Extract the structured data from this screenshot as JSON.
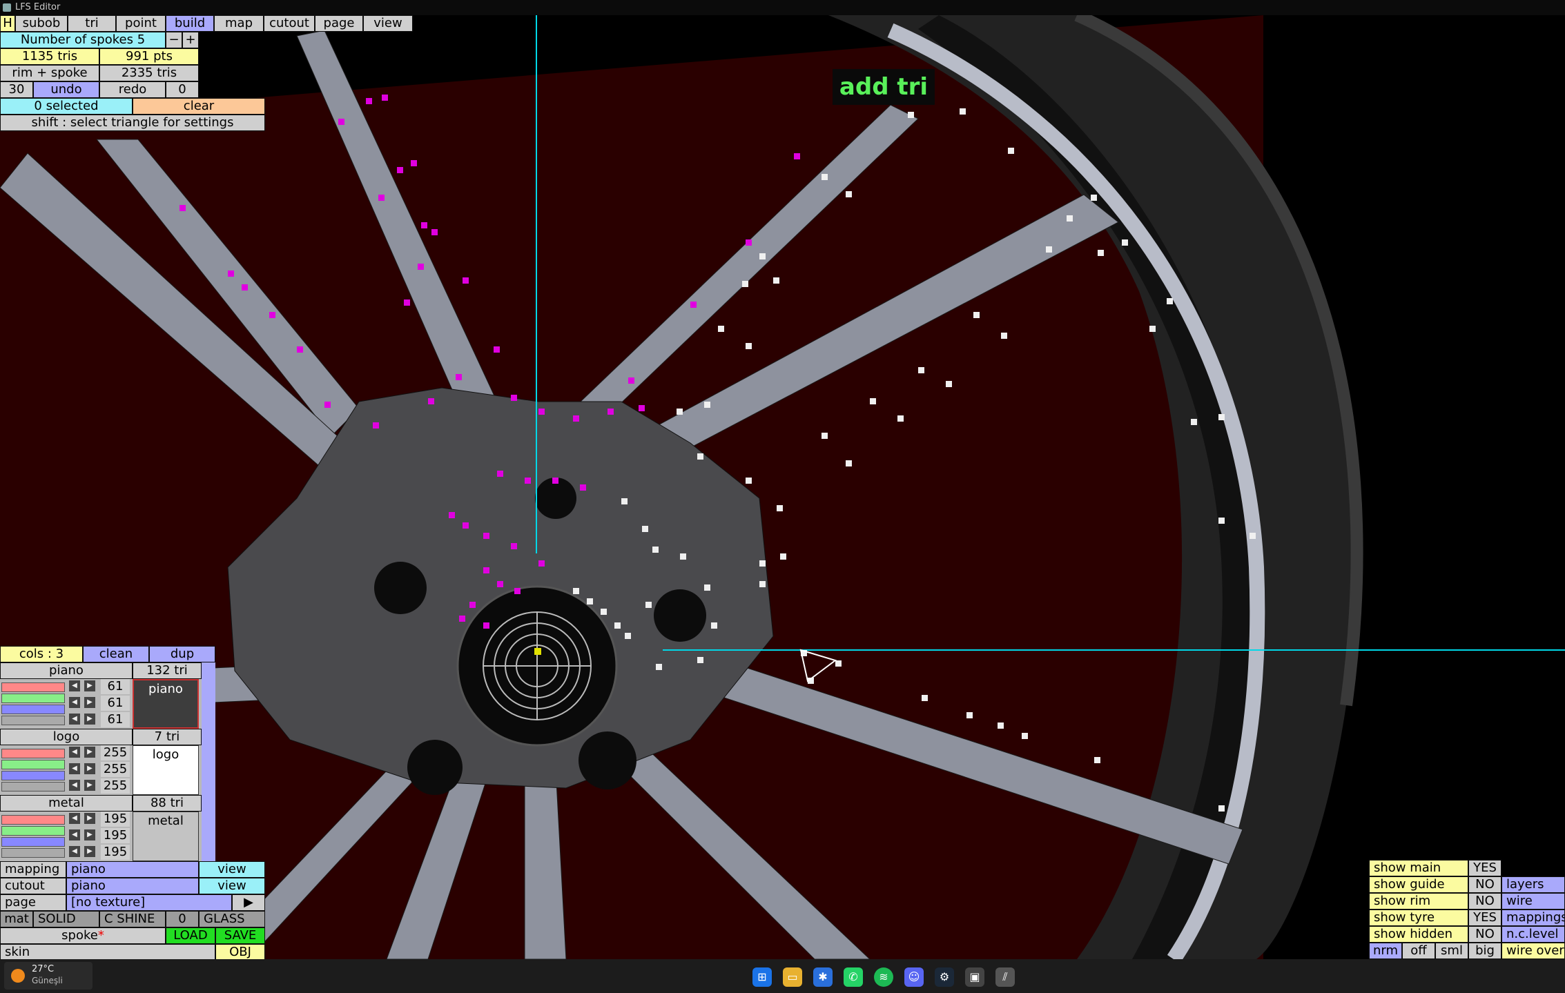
{
  "window": {
    "title": "LFS Editor"
  },
  "menu": [
    "H",
    "subob",
    "tri",
    "point",
    "build",
    "map",
    "cutout",
    "page",
    "view"
  ],
  "spokes": {
    "label": "Number of spokes 5",
    "minus": "−",
    "plus": "+"
  },
  "stats": {
    "tris": "1135 tris",
    "pts": "991 pts",
    "rim_spoke": "rim + spoke",
    "total_tris": "2335 tris"
  },
  "history": {
    "count": "30",
    "undo": "undo",
    "redo": "redo",
    "redo_count": "0"
  },
  "selection": {
    "selected": "0 selected",
    "clear": "clear",
    "hint": "shift : select triangle for settings"
  },
  "overlay": {
    "mode": "add tri"
  },
  "colours": {
    "header": "cols : 3",
    "clean": "clean",
    "dup": "dup",
    "items": [
      {
        "name": "piano",
        "tri": "132 tri",
        "r": "61",
        "g": "61",
        "b": "61",
        "preview": "piano",
        "preview_color": "#3d3d3d",
        "text_color": "#ffffff"
      },
      {
        "name": "logo",
        "tri": "7 tri",
        "r": "255",
        "g": "255",
        "b": "255",
        "preview": "logo",
        "preview_color": "#ffffff",
        "text_color": "#000000"
      },
      {
        "name": "metal",
        "tri": "88 tri",
        "r": "195",
        "g": "195",
        "b": "195",
        "preview": "metal",
        "preview_color": "#c3c3c3",
        "text_color": "#000000"
      }
    ]
  },
  "material": {
    "mapping_label": "mapping",
    "mapping_value": "piano",
    "mapping_view": "view",
    "cutout_label": "cutout",
    "cutout_value": "piano",
    "cutout_view": "view",
    "page_label": "page",
    "page_value": "[no texture]",
    "page_arrow": "▶",
    "mat": "mat",
    "solid": "SOLID",
    "cshine": "C SHINE",
    "shine_val": "0",
    "glass": "GLASS",
    "file": "spoke",
    "file_mark": "*",
    "load": "LOAD",
    "save": "SAVE",
    "skin": "skin",
    "obj": "OBJ"
  },
  "view_options": {
    "rows": [
      {
        "label": "show main",
        "value": "YES",
        "side": "layers"
      },
      {
        "label": "show guide",
        "value": "NO",
        "side": "layers"
      },
      {
        "label": "show rim",
        "value": "NO",
        "side": "wire"
      },
      {
        "label": "show tyre",
        "value": "YES",
        "side": "mappings"
      },
      {
        "label": "show hidden",
        "value": "NO",
        "side": "n.c.level"
      }
    ],
    "bottom": [
      "nrm",
      "off",
      "sml",
      "big",
      "wire overlay"
    ]
  },
  "taskbar": {
    "temp": "27°C",
    "weather": "Güneşli"
  },
  "colors": {
    "menu_active": "#a9a9fb",
    "accent_green": "#59f05a",
    "guide_cyan": "#00d8e8",
    "selected_vertex": "#e000e0"
  }
}
